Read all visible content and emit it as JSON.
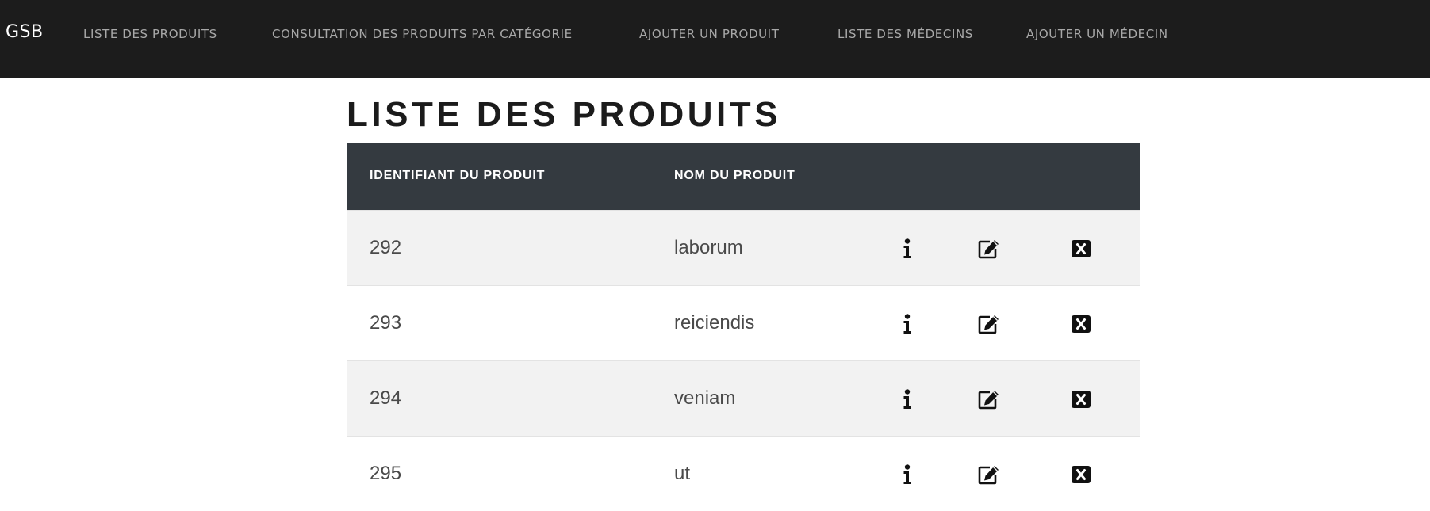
{
  "navbar": {
    "brand": "GSB",
    "links": [
      "LISTE DES PRODUITS",
      "CONSULTATION DES PRODUITS PAR CATÉGORIE",
      "AJOUTER UN PRODUIT",
      "LISTE DES MÉDECINS",
      "AJOUTER UN MÉDECIN"
    ]
  },
  "main": {
    "title": "LISTE DES PRODUITS",
    "table": {
      "headers": [
        "IDENTIFIANT DU PRODUIT",
        "NOM DU PRODUIT"
      ],
      "rows": [
        {
          "id": "292",
          "name": "laborum"
        },
        {
          "id": "293",
          "name": "reiciendis"
        },
        {
          "id": "294",
          "name": "veniam"
        },
        {
          "id": "295",
          "name": "ut"
        }
      ],
      "row_actions": [
        "info-icon",
        "edit-icon",
        "delete-icon"
      ]
    }
  },
  "colors": {
    "navbar_bg": "#1c1c1c",
    "table_header_bg": "#343a40",
    "row_striped_bg": "#f2f2f2"
  }
}
